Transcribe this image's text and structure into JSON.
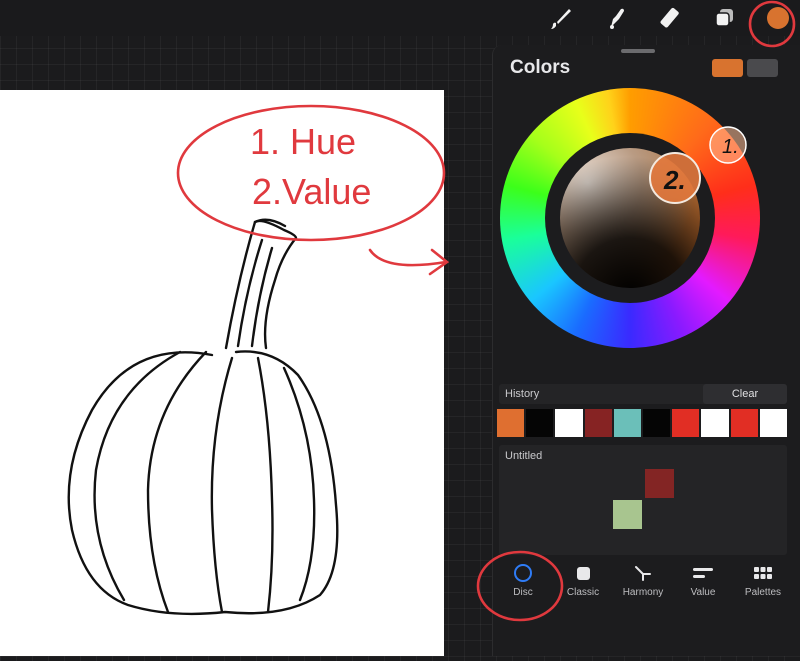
{
  "toolbar": {
    "tools": [
      "paintbrush-icon",
      "smudge-icon",
      "eraser-icon",
      "layers-icon",
      "color-button"
    ],
    "current_color": "#d8732f"
  },
  "colors_panel": {
    "title": "Colors",
    "primary_swatch": "#d8732f",
    "secondary_swatch": "#4a4a4d",
    "history": {
      "label": "History",
      "clear_label": "Clear",
      "swatches": [
        "#df6f30",
        "#050505",
        "#ffffff",
        "#862323",
        "#6bbfb9",
        "#050505",
        "#e12e24",
        "#ffffff",
        "#e12e24",
        "#ffffff"
      ]
    },
    "palette": {
      "name": "Untitled",
      "swatches": [
        "#832524",
        "#a8c58f"
      ]
    },
    "tabs": [
      {
        "label": "Disc",
        "icon": "disc-icon",
        "active": true
      },
      {
        "label": "Classic",
        "icon": "classic-icon",
        "active": false
      },
      {
        "label": "Harmony",
        "icon": "harmony-icon",
        "active": false
      },
      {
        "label": "Value",
        "icon": "value-icon",
        "active": false
      },
      {
        "label": "Palettes",
        "icon": "palettes-icon",
        "active": false
      }
    ]
  },
  "annotations": {
    "oval_line1": "1. Hue",
    "oval_line2": "2.Value",
    "marker1": "1.",
    "marker2": "2.",
    "accent_color": "#e0393e"
  }
}
